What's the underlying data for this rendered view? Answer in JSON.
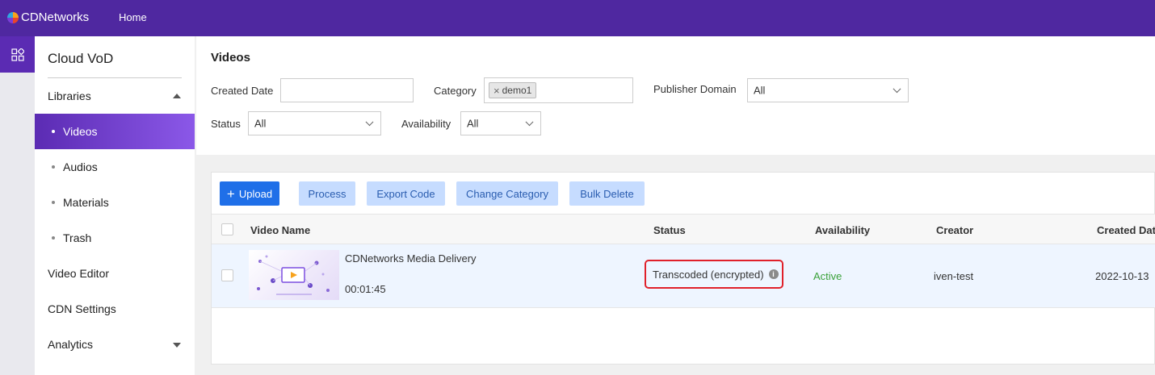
{
  "header": {
    "brand": "CDNetworks",
    "home": "Home"
  },
  "sidebar": {
    "title": "Cloud VoD",
    "libraries": "Libraries",
    "sub_items": [
      "Videos",
      "Audios",
      "Materials",
      "Trash"
    ],
    "video_editor": "Video Editor",
    "cdn_settings": "CDN Settings",
    "analytics": "Analytics"
  },
  "filters": {
    "title": "Videos",
    "created_date_label": "Created Date",
    "created_date_value": "",
    "category_label": "Category",
    "category_tag": "demo1",
    "publisher_domain_label": "Publisher Domain",
    "publisher_domain_value": "All",
    "status_label": "Status",
    "status_value": "All",
    "availability_label": "Availability",
    "availability_value": "All"
  },
  "toolbar": {
    "upload": "Upload",
    "process": "Process",
    "export_code": "Export Code",
    "change_category": "Change Category",
    "bulk_delete": "Bulk Delete"
  },
  "table": {
    "columns": [
      "Video Name",
      "Status",
      "Availability",
      "Creator",
      "Created Dat"
    ],
    "rows": [
      {
        "name": "CDNetworks Media Delivery",
        "duration": "00:01:45",
        "status": "Transcoded (encrypted)",
        "availability": "Active",
        "creator": "iven-test",
        "created": "2022-10-13"
      }
    ]
  },
  "colors": {
    "header_bg": "#4f28a0",
    "accent": "#1f6fe8",
    "active_green": "#3aa13a",
    "highlight_red": "#e0202a"
  }
}
